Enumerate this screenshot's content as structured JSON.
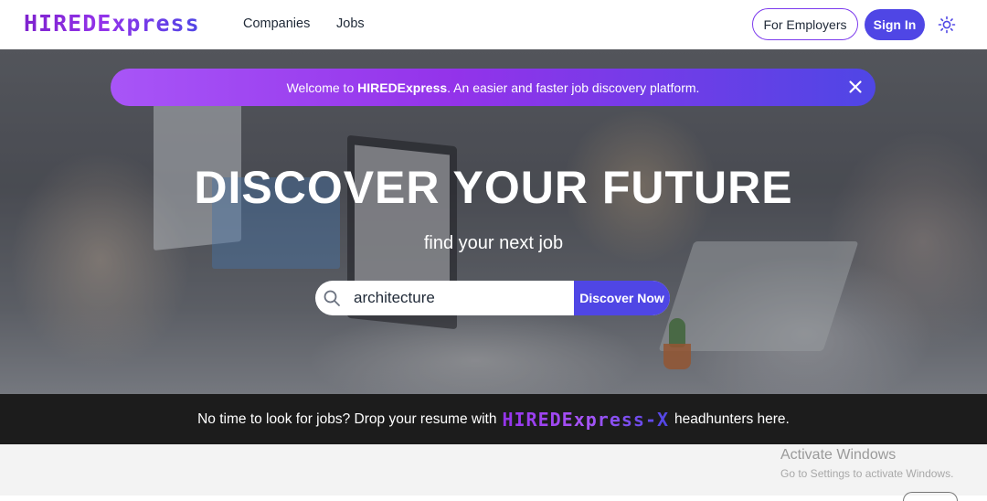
{
  "header": {
    "logo": "HIREDExpress",
    "nav": {
      "companies": "Companies",
      "jobs": "Jobs"
    },
    "for_employers": "For Employers",
    "sign_in": "Sign In",
    "theme_icon": "sun-icon"
  },
  "banner": {
    "prefix": "Welcome to ",
    "brand": "HIREDExpress",
    "suffix": ". An easier and faster job discovery platform.",
    "close_icon": "close-icon"
  },
  "hero": {
    "title": "DISCOVER YOUR FUTURE",
    "subtitle": "find your next job"
  },
  "search": {
    "value": "architecture",
    "button": "Discover Now",
    "icon": "search-icon"
  },
  "strip": {
    "prefix": "No time to look for jobs? Drop your resume with",
    "brand": "HIREDExpress-X",
    "suffix": "headhunters here."
  },
  "watermark": {
    "title": "Activate Windows",
    "subtitle": "Go to Settings to activate Windows."
  },
  "colors": {
    "primary": "#4f46e5",
    "purple": "#9333ea",
    "strip_bg": "#1c1c1c"
  }
}
